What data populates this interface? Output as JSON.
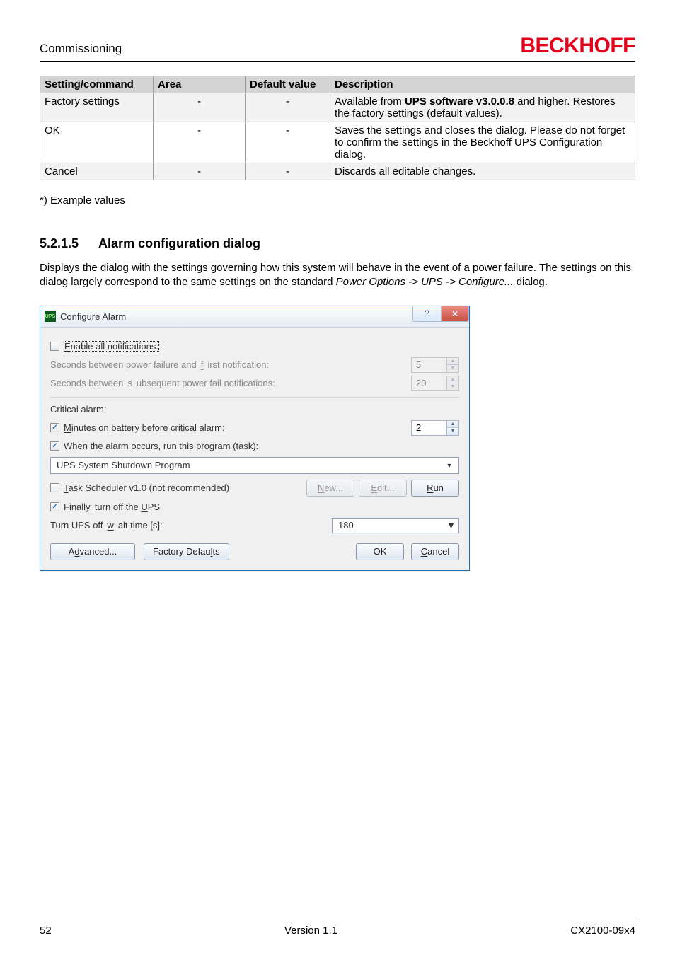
{
  "header": {
    "section": "Commissioning",
    "brand": "BECKHOFF"
  },
  "table": {
    "headers": [
      "Setting/command",
      "Area",
      "Default value",
      "Description"
    ],
    "rows": [
      {
        "name": "Factory settings",
        "area": "-",
        "def": "-",
        "desc_pre": "Available from ",
        "desc_bold": "UPS software v3.0.0.8",
        "desc_post": " and higher. Restores the factory settings (default values)."
      },
      {
        "name": "OK",
        "area": "-",
        "def": "-",
        "desc": "Saves the settings and closes the dialog. Please do not forget to confirm the settings in the Beckhoff UPS Configuration dialog."
      },
      {
        "name": "Cancel",
        "area": "-",
        "def": "-",
        "desc": "Discards all editable changes."
      }
    ]
  },
  "footnote": "*) Example values",
  "section": {
    "num": "5.2.1.5",
    "title": "Alarm configuration dialog",
    "para_a": "Displays the dialog with the settings governing how this system will behave in the event of a power failure. The settings on this dialog largely correspond to the same settings on the standard ",
    "para_i": "Power Options -> UPS -> Configure...",
    "para_b": " dialog."
  },
  "dialog": {
    "title": "Configure Alarm",
    "help_glyph": "?",
    "close_glyph": "×",
    "enable_all_pre": "E",
    "enable_all_rest": "nable all notifications.",
    "sec_first_a": "Seconds between power failure and ",
    "sec_first_u": "f",
    "sec_first_b": "irst notification:",
    "sec_first_val": "5",
    "sec_sub_a": "Seconds between ",
    "sec_sub_u": "s",
    "sec_sub_b": "ubsequent power fail notifications:",
    "sec_sub_val": "20",
    "critical_heading": "Critical alarm:",
    "minutes_u": "M",
    "minutes_rest": "inutes on battery before critical alarm:",
    "minutes_val": "2",
    "runprog_a": "When the alarm occurs, run this ",
    "runprog_u": "p",
    "runprog_b": "rogram (task):",
    "combo_value": "UPS System Shutdown Program",
    "task_u": "T",
    "task_rest": "ask Scheduler v1.0 (not recommended)",
    "new_u": "N",
    "new_rest": "ew...",
    "edit_u": "E",
    "edit_rest": "dit...",
    "run_u": "R",
    "run_rest": "un",
    "finally_a": "Finally, turn off the ",
    "finally_u": "U",
    "finally_b": "PS",
    "wait_a": "Turn UPS off ",
    "wait_u": "w",
    "wait_b": "ait time [s]:",
    "wait_val": "180",
    "advanced_a": "A",
    "advanced_u": "d",
    "advanced_b": "vanced...",
    "factory_a": "Factory Defau",
    "factory_u": "l",
    "factory_b": "ts",
    "ok": "OK",
    "cancel_u": "C",
    "cancel_rest": "ancel"
  },
  "footer": {
    "page": "52",
    "version": "Version 1.1",
    "doc": "CX2100-09x4"
  }
}
